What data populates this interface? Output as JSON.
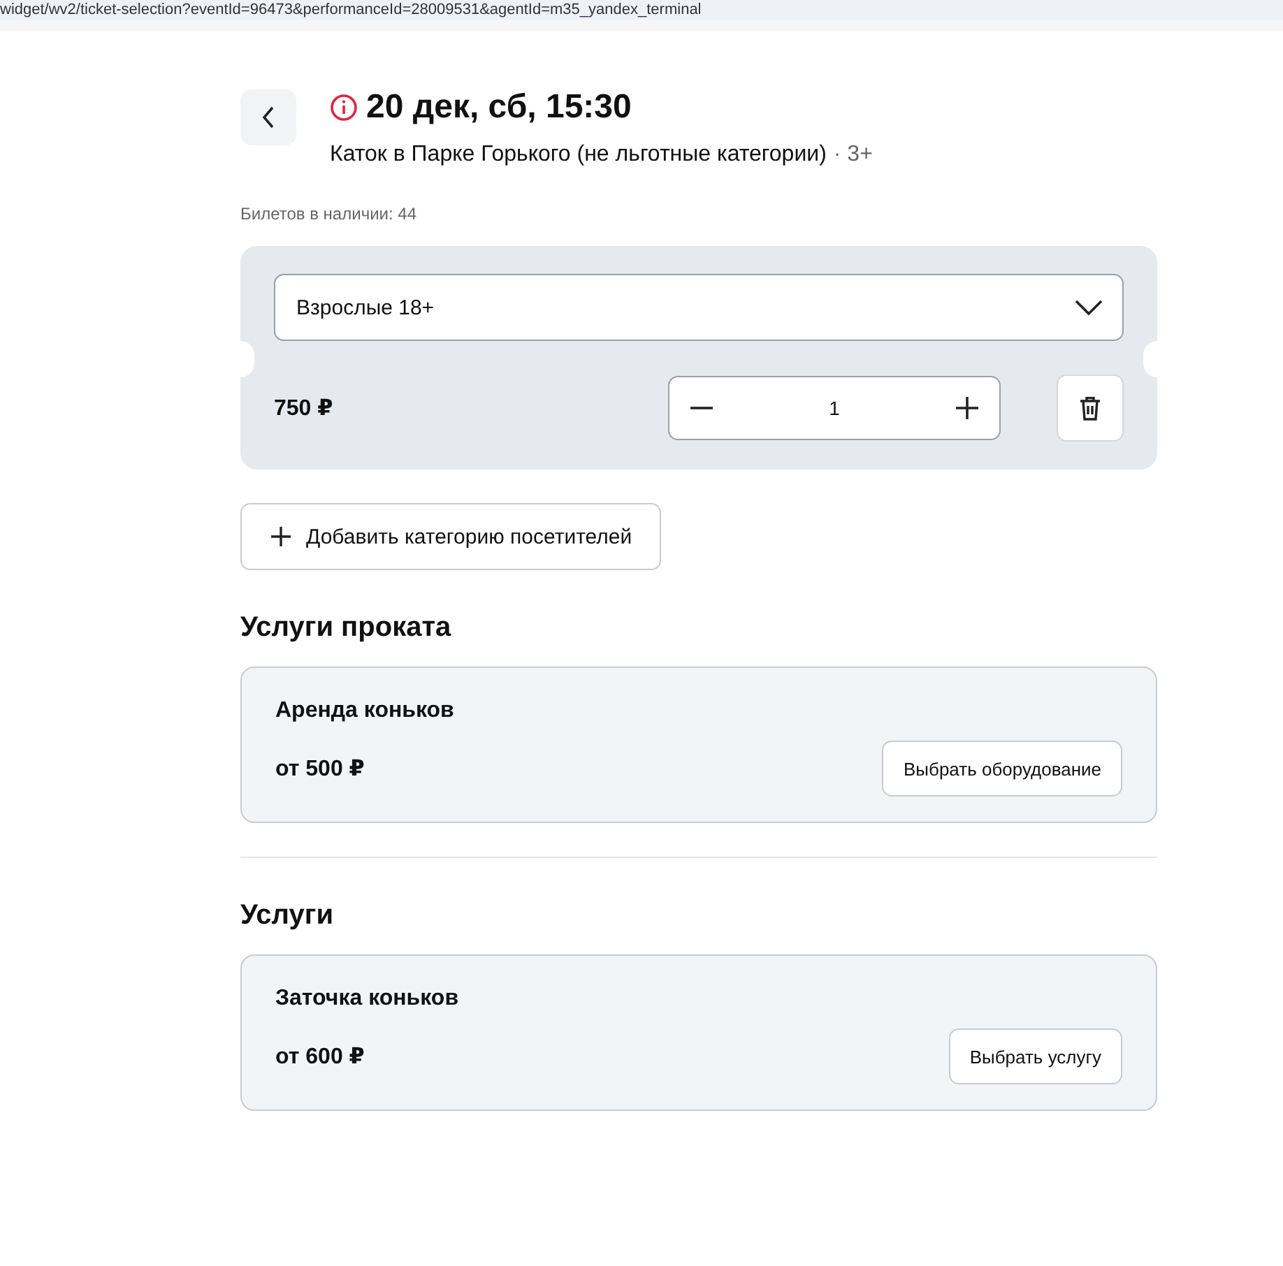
{
  "address_bar": {
    "url": "widget/wv2/ticket-selection?eventId=96473&performanceId=28009531&agentId=m35_yandex_terminal"
  },
  "header": {
    "date": "20 дек, сб, 15:30",
    "event": "Каток в Парке Горького (не льготные категории)",
    "age": "· 3+"
  },
  "availability": "Билетов в наличии: 44",
  "tickets": [
    {
      "category": "Взрослые 18+",
      "price": "750 ₽",
      "quantity": "1"
    }
  ],
  "add_category_button": "Добавить категорию посетителей",
  "sections": [
    {
      "title": "Услуги проката",
      "items": [
        {
          "name": "Аренда коньков",
          "price": "от 500 ₽",
          "button": "Выбрать оборудование"
        }
      ]
    },
    {
      "title": "Услуги",
      "items": [
        {
          "name": "Заточка коньков",
          "price": "от 600 ₽",
          "button": "Выбрать услугу"
        }
      ]
    }
  ]
}
